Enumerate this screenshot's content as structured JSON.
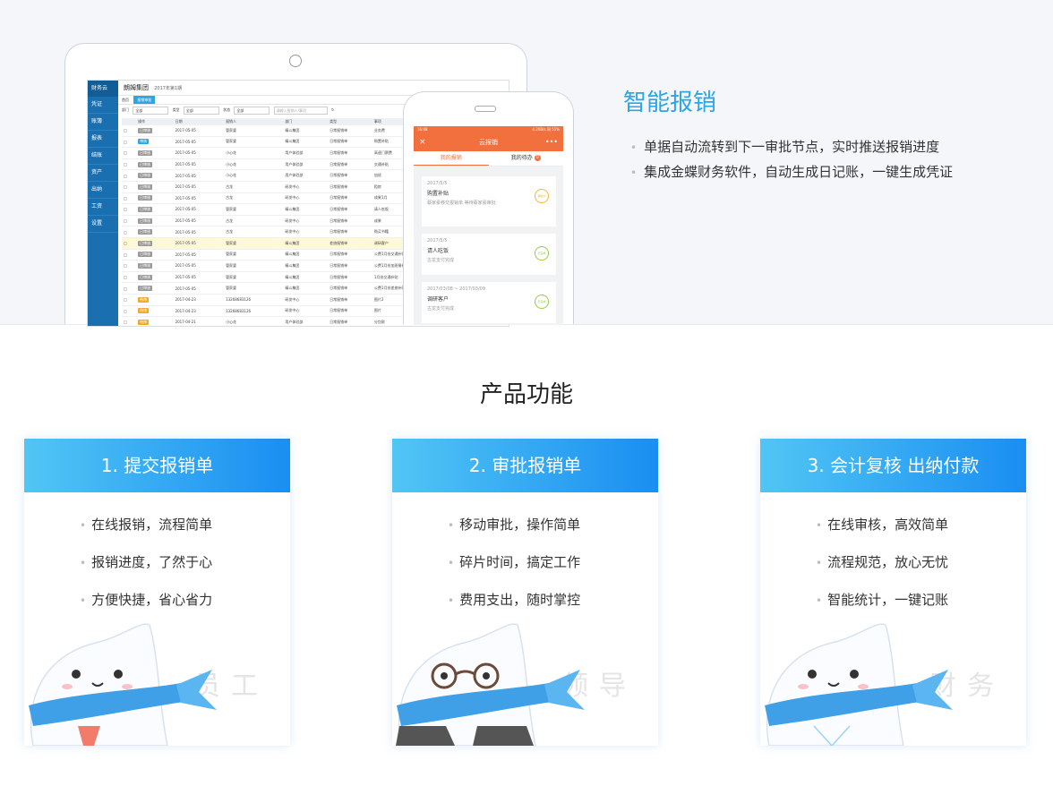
{
  "hero": {
    "title": "智能报销",
    "bullets": [
      "单据自动流转到下一审批节点，实时推送报销进度",
      "集成金蝶财务软件，自动生成日记账，一键生成凭证"
    ]
  },
  "desktop_app": {
    "brand": "财务云",
    "company": "朗姆集团",
    "period": "2017年第1期",
    "nav": [
      "凭证",
      "账簿",
      "报表",
      "结账",
      "资产",
      "出纳",
      "工资",
      "设置"
    ],
    "tabs": [
      "首页",
      "报销审批"
    ],
    "filters": {
      "dept_label": "部门",
      "dept_value": "全部",
      "type_label": "类型",
      "type_value": "全部",
      "status_label": "状态",
      "status_value": "全部",
      "search_placeholder": "请输入报销人/事项"
    },
    "table_headers": [
      "",
      "操作",
      "日期",
      "报销人",
      "部门",
      "类型",
      "事项",
      "金额",
      "单据"
    ],
    "rows": [
      [
        "已审核",
        "2017-05-05",
        "管家婆",
        "精斗集团",
        "日常报销单",
        "业务费",
        "180.00"
      ],
      [
        "审核",
        "2017-05-05",
        "管家婆",
        "精斗集团",
        "日常报销单",
        "购置补贴",
        "256.00"
      ],
      [
        "已审核",
        "2017-05-05",
        "小心花",
        "用户体验部",
        "日常报销单",
        "高速门票费",
        "22.60"
      ],
      [
        "已审核",
        "2017-05-05",
        "小心花",
        "用户体验部",
        "日常报销单",
        "交通补贴",
        "150.00"
      ],
      [
        "已审核",
        "2017-05-05",
        "小心花",
        "用户体验部",
        "日常报销单",
        "加班",
        "12.00"
      ],
      [
        "已审核",
        "2017-05-05",
        "古龙",
        "研发中心",
        "日常报销单",
        "租房",
        "122.00"
      ],
      [
        "已审核",
        "2017-05-05",
        "古龙",
        "研发中心",
        "日常报销单",
        "成果1月",
        "210.00"
      ],
      [
        "已审核",
        "2017-05-05",
        "管家婆",
        "精斗集团",
        "日常报销单",
        "请人吃饭",
        "368.00"
      ],
      [
        "已审核",
        "2017-05-05",
        "古龙",
        "研发中心",
        "日常报销单",
        "成果",
        "200.00"
      ],
      [
        "已审核",
        "2017-05-05",
        "古龙",
        "研发中心",
        "日常报销单",
        "购买书籍",
        "408.00"
      ],
      [
        "已审核",
        "2017-05-05",
        "管家婆",
        "精斗集团",
        "差旅报销单",
        "调研客户",
        "362.00"
      ],
      [
        "已审核",
        "2017-05-05",
        "管家婆",
        "精斗集团",
        "日常报销单",
        "公费1月份交通补贴",
        "1,206.78"
      ],
      [
        "已审核",
        "2017-05-05",
        "管家婆",
        "精斗集团",
        "日常报销单",
        "公费1月份加班餐补",
        "940.00"
      ],
      [
        "已审核",
        "2017-05-05",
        "管家婆",
        "精斗集团",
        "日常报销单",
        "1月份交通补贴",
        "1,025.43"
      ],
      [
        "已审核",
        "2017-05-05",
        "管家婆",
        "精斗集团",
        "日常报销单",
        "公费1月份差旅补贴",
        "900.00"
      ],
      [
        "待审",
        "2017-04-23",
        "13268683126",
        "研发中心",
        "日常报销单",
        "图片2",
        "3.69"
      ],
      [
        "待审",
        "2017-04-23",
        "13268683126",
        "研发中心",
        "日常报销单",
        "图片",
        "39.00"
      ],
      [
        "待审",
        "2017-04-21",
        "小心花",
        "用户体验部",
        "日常报销单",
        "分包款",
        "100.00"
      ]
    ]
  },
  "mobile_app": {
    "status_time": "16:08",
    "status_right": "4.2KB/s 网 55%",
    "title": "云报销",
    "tab_mine": "我的报销",
    "tab_todo": "我的待办",
    "todo_count": "0",
    "cards": [
      {
        "date": "2017/5/5",
        "title": "购置补贴",
        "status": "蔡家豪移交报销单 等待蔡家豪审批",
        "stamp": "审批中"
      },
      {
        "date": "2017/5/5",
        "title": "请人吃饭",
        "status": "古龙支付完成",
        "stamp": "已完成"
      },
      {
        "date": "2017/03/08 ~ 2017/03/09",
        "title": "调研客户",
        "status": "古龙支付完成",
        "stamp": "已完成"
      }
    ]
  },
  "features": {
    "title": "产品功能",
    "cards": [
      {
        "head": "1. 提交报销单",
        "items": [
          "在线报销，流程简单",
          "报销进度，了然于心",
          "方便快捷，省心省力"
        ],
        "role": "员工"
      },
      {
        "head": "2. 审批报销单",
        "items": [
          "移动审批，操作简单",
          "碎片时间，搞定工作",
          "费用支出，随时掌控"
        ],
        "role": "领导"
      },
      {
        "head": "3. 会计复核 出纳付款",
        "items": [
          "在线审核，高效简单",
          "流程规范，放心无忧",
          "智能统计，一键记账"
        ],
        "role": "财务"
      }
    ]
  },
  "colors": {
    "accent": "#28a6e6",
    "phone_bar": "#f26f3e",
    "head_from": "#51c6f4",
    "head_to": "#1a8ef2"
  }
}
